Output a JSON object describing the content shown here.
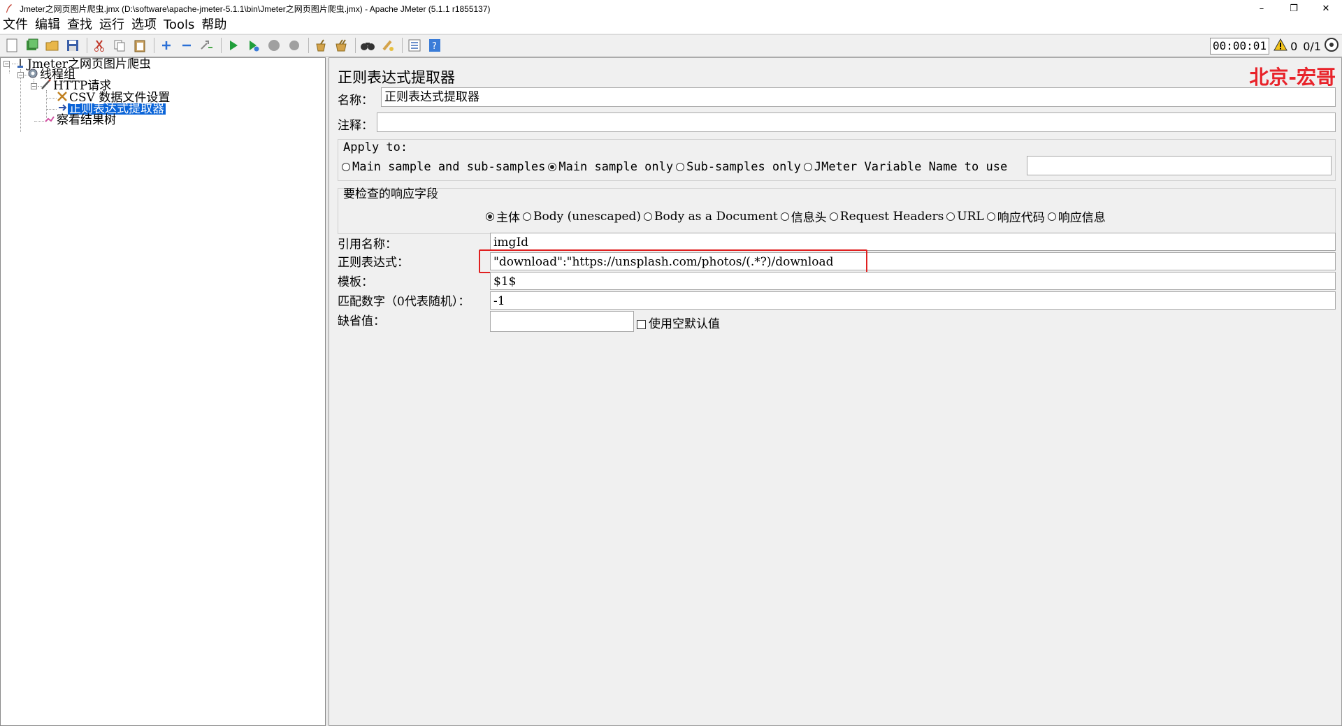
{
  "window": {
    "title": "Jmeter之网页图片爬虫.jmx (D:\\software\\apache-jmeter-5.1.1\\bin\\Jmeter之网页图片爬虫.jmx) - Apache JMeter (5.1.1 r1855137)",
    "minimize": "–",
    "restore": "❐",
    "close": "✕"
  },
  "menu": [
    "文件",
    "编辑",
    "查找",
    "运行",
    "选项",
    "Tools",
    "帮助"
  ],
  "toolbar": {
    "timer": "00:00:01",
    "warnings": "0",
    "threads": "0/1"
  },
  "tree": {
    "root": "Jmeter之网页图片爬虫",
    "thread_group": "线程组",
    "http_request": "HTTP请求",
    "csv_config": "CSV 数据文件设置",
    "regex_extractor": "正则表达式提取器",
    "result_tree": "察看结果树"
  },
  "panel": {
    "title": "正则表达式提取器",
    "watermark": "北京-宏哥",
    "name_label": "名称：",
    "name_value": "正则表达式提取器",
    "comment_label": "注释：",
    "comment_value": "",
    "apply_to_label": "Apply to:",
    "apply_options": [
      "Main sample and sub-samples",
      "Main sample only",
      "Sub-samples only",
      "JMeter Variable Name to use"
    ],
    "apply_selected": 1,
    "variable_name_value": "",
    "field_check_label": "要检查的响应字段",
    "field_options": [
      "主体",
      "Body (unescaped)",
      "Body as a Document",
      "信息头",
      "Request Headers",
      "URL",
      "响应代码",
      "响应信息"
    ],
    "field_selected": 0,
    "ref_name_label": "引用名称：",
    "ref_name_value": "imgId",
    "regex_label": "正则表达式：",
    "regex_value": "\"download\":\"https://unsplash.com/photos/(.*?)/download",
    "template_label": "模板：",
    "template_value": "$1$",
    "match_no_label": "匹配数字（0代表随机）：",
    "match_no_value": "-1",
    "default_label": "缺省值：",
    "default_value": "",
    "use_empty_default_label": "使用空默认值"
  }
}
